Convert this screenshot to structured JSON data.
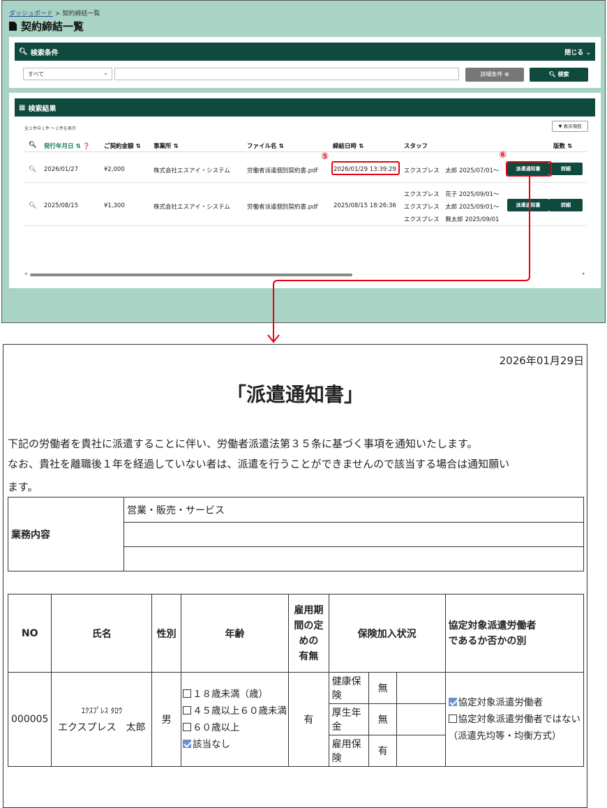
{
  "breadcrumb": {
    "home": "ダッシュボード",
    "separator": ">",
    "current": "契約締結一覧"
  },
  "page_title": "契約締結一覧",
  "search": {
    "header": "検索条件",
    "close_label": "閉じる",
    "select_value": "すべて",
    "keyword_value": "",
    "detail_button": "詳細条件 ⊕",
    "search_button": "検索"
  },
  "results": {
    "header": "検索結果",
    "count_text": "全２件中１件 〜２件を表示",
    "columns_button": "▼ 表示項目",
    "columns": [
      "発行年月日",
      "ご契約金額",
      "事業所",
      "ファイル名",
      "締結日時",
      "スタッフ",
      "版数"
    ],
    "sort_icon": "⇅",
    "rows": [
      {
        "date": "2026/01/27",
        "amount": "¥2,000",
        "office": "株式会社エスアイ・システム",
        "file": "労働者派遣個別契約書.pdf",
        "signed_at": "2026/01/29 13:39:29",
        "staff": [
          "エクスプレス　太郎 2025/07/01〜"
        ],
        "notice_button": "派遣通知書",
        "detail_button": "詳細"
      },
      {
        "date": "2025/08/15",
        "amount": "¥1,300",
        "office": "株式会社エスアイ・システム",
        "file": "労働者派遣個別契約書.pdf",
        "signed_at": "2025/08/15 18:26:36",
        "staff": [
          "エクスプレス　花子 2025/09/01〜",
          "エクスプレス　太郎 2025/09/01〜",
          "エクスプレス　無太郎 2025/09/01"
        ],
        "notice_button": "派遣通知書",
        "detail_button": "詳細"
      }
    ]
  },
  "annotations": {
    "marker5": "⑤",
    "marker6": "⑥"
  },
  "highlight_color": "#e60012",
  "brand_color": "#0f4a3e",
  "document": {
    "date": "2026年01月29日",
    "title": "「派遣通知書」",
    "para1": "下記の労働者を貴社に派遣することに伴い、労働者派遣法第３５条に基づく事項を通知いたします。",
    "para2": "なお、貴社を離職後１年を経過していない者は、派遣を行うことができませんので該当する場合は通知願い",
    "para3": "ます。",
    "job_label": "業務内容",
    "job_values": [
      "営業・販売・サービス",
      "",
      ""
    ],
    "headers": {
      "no": "NO",
      "name": "氏名",
      "sex": "性別",
      "age": "年齢",
      "term": [
        "雇用期",
        "間の定",
        "めの",
        "有無"
      ],
      "insurance": "保険加入状況",
      "agreement": [
        "協定対象派遣労働者",
        "であるか否かの別"
      ]
    },
    "row": {
      "no": "000005",
      "kana": "ｴｸｽﾌﾟﾚｽ ﾀﾛｳ",
      "name": "エクスプレス　太郎",
      "sex": "男",
      "age_options": [
        {
          "label": "１８歳未満（歳）",
          "checked": false
        },
        {
          "label": "４５歳以上６０歳未満",
          "checked": false
        },
        {
          "label": "６０歳以上",
          "checked": false
        },
        {
          "label": "該当なし",
          "checked": true
        }
      ],
      "term": "有",
      "insurance": [
        {
          "name": "健康保険",
          "value": "無"
        },
        {
          "name": "厚生年金",
          "value": "無"
        },
        {
          "name": "雇用保険",
          "value": "有"
        }
      ],
      "agreement_options": [
        {
          "label": "協定対象派遣労働者",
          "checked": true
        },
        {
          "label": "協定対象派遣労働者ではない",
          "checked": false
        }
      ],
      "agreement_note": "（派遣先均等・均衡方式）"
    }
  }
}
